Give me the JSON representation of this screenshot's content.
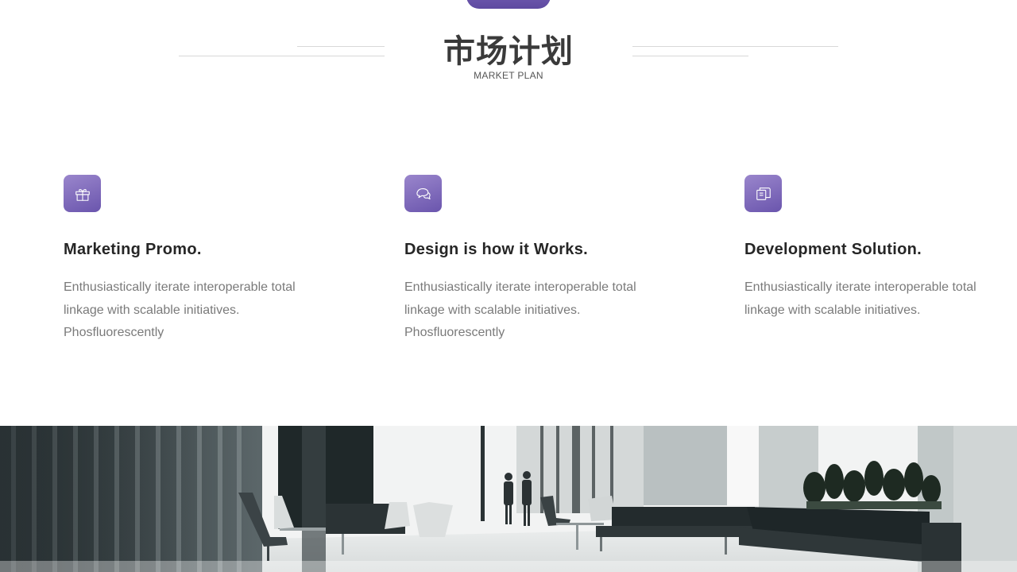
{
  "header": {
    "title": "市场计划",
    "subtitle": "MARKET PLAN"
  },
  "features": [
    {
      "icon": "gift-icon",
      "title": "Marketing Promo.",
      "text": "Enthusiastically  iterate interoperable total\nlinkage with scalable initiatives.\nPhosfluorescently"
    },
    {
      "icon": "chat-bubbles-icon",
      "title": "Design is how it Works.",
      "text": "Enthusiastically  iterate interoperable total\nlinkage with scalable initiatives.\nPhosfluorescently"
    },
    {
      "icon": "copy-pages-icon",
      "title": "Development Solution.",
      "text": "Enthusiastically  iterate interoperable total\nlinkage with scalable initiatives."
    }
  ],
  "colors": {
    "accent": "#6a55ad",
    "accent_light": "#9a86cc",
    "title_text": "#3a3a3a",
    "body_text": "#7a7a7a"
  }
}
